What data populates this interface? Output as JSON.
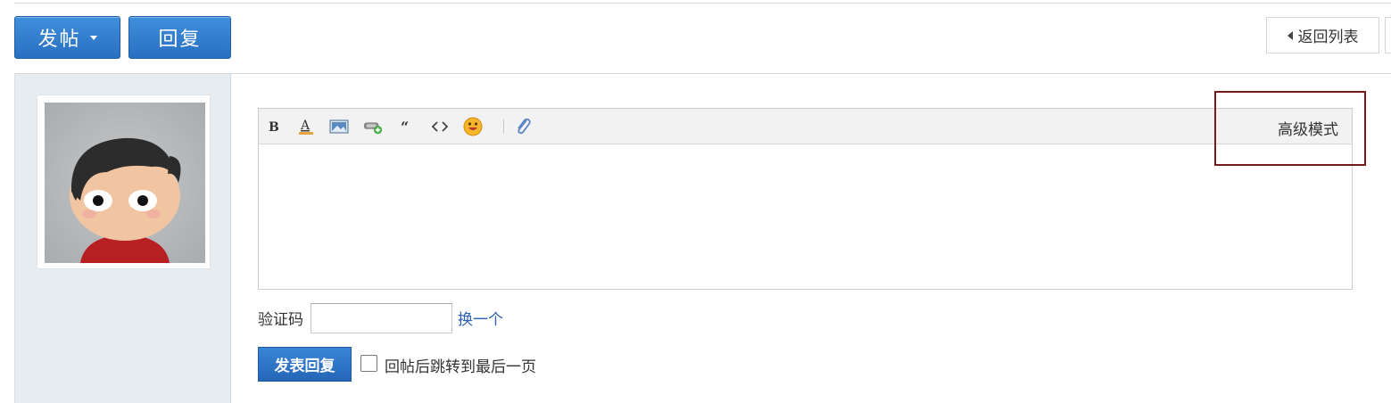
{
  "header": {
    "post_button": "发帖",
    "reply_button": "回复",
    "back_to_list": "返回列表"
  },
  "editor": {
    "toolbar": {
      "bold_icon": "bold-icon",
      "font_color_icon": "font-color-icon",
      "image_icon": "image-icon",
      "link_icon": "link-icon",
      "quote_icon": "quote-icon",
      "code_icon": "code-icon",
      "smiley_icon": "smiley-icon",
      "attachment_icon": "paperclip-icon",
      "advanced_mode": "高级模式"
    },
    "content": ""
  },
  "captcha": {
    "label": "验证码",
    "value": "",
    "change_link": "换一个"
  },
  "submit": {
    "button": "发表回复",
    "jump_checkbox_label": "回帖后跳转到最后一页",
    "jump_checked": false
  },
  "colors": {
    "primary_blue": "#2a6fc1",
    "link_blue": "#2b62b1",
    "sidebar_bg": "#e5edf2",
    "highlight_box": "#7a1a1a"
  }
}
